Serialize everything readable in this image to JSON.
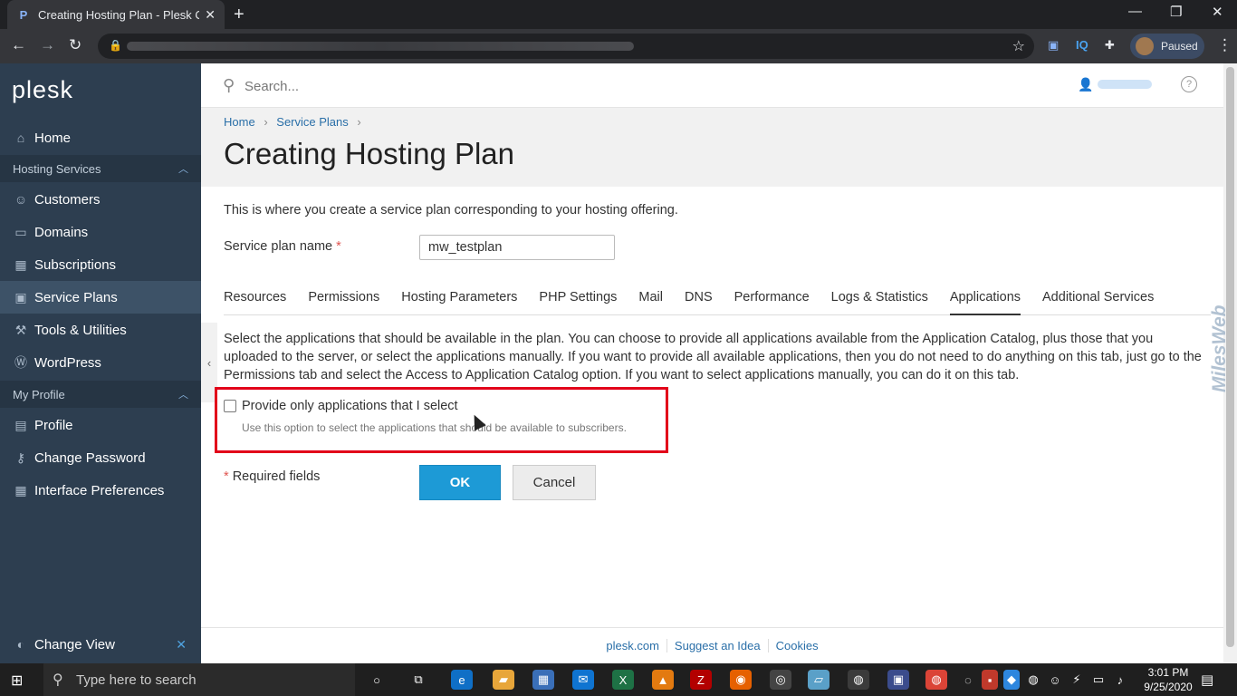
{
  "browser": {
    "tab_title": "Creating Hosting Plan - Plesk Ob",
    "tab_favicon": "P",
    "profile_status": "Paused",
    "ext_iq": "IQ"
  },
  "sidebar": {
    "logo": "plesk",
    "items": [
      {
        "label": "Home",
        "icon": "⌂"
      },
      {
        "label": "Customers",
        "icon": "☺"
      },
      {
        "label": "Domains",
        "icon": "▭"
      },
      {
        "label": "Subscriptions",
        "icon": "▦"
      },
      {
        "label": "Service Plans",
        "icon": "▣"
      },
      {
        "label": "Tools & Utilities",
        "icon": "⚒"
      },
      {
        "label": "WordPress",
        "icon": "Ⓦ"
      },
      {
        "label": "Profile",
        "icon": "▤"
      },
      {
        "label": "Change Password",
        "icon": "⚷"
      },
      {
        "label": "Interface Preferences",
        "icon": "▦"
      }
    ],
    "groups": [
      "Hosting Services",
      "My Profile"
    ],
    "change_view": "Change View"
  },
  "search": {
    "placeholder": "Search..."
  },
  "breadcrumb": [
    "Home",
    "Service Plans"
  ],
  "page": {
    "title": "Creating Hosting Plan",
    "intro": "This is where you create a service plan corresponding to your hosting offering.",
    "plan_name_label": "Service plan name",
    "required_mark": "*",
    "plan_name_value": "mw_testplan"
  },
  "tabs": [
    "Resources",
    "Permissions",
    "Hosting Parameters",
    "PHP Settings",
    "Mail",
    "DNS",
    "Performance",
    "Logs & Statistics",
    "Applications",
    "Additional Services"
  ],
  "active_tab": "Applications",
  "applications": {
    "description": "Select the applications that should be available in the plan. You can choose to provide all applications available from the Application Catalog, plus those that you uploaded to the server, or select the applications manually. If you want to provide all available applications, then you do not need to do anything on this tab, just go to the Permissions tab and select the Access to Application Catalog option. If you want to select applications manually, you can do it on this tab.",
    "checkbox_label": "Provide only applications that I select",
    "checkbox_checked": false,
    "checkbox_hint": "Use this option to select the applications that should be available to subscribers."
  },
  "form": {
    "required_note": "Required fields",
    "ok_label": "OK",
    "cancel_label": "Cancel"
  },
  "footer": [
    "plesk.com",
    "Suggest an Idea",
    "Cookies"
  ],
  "watermark": "MilesWeb",
  "taskbar": {
    "search_placeholder": "Type here to search",
    "time": "3:01 PM",
    "date": "9/25/2020"
  },
  "colors": {
    "sidebar_bg": "#2d3e50",
    "accent_blue": "#1d9ad6",
    "highlight_red": "#e2001a"
  }
}
